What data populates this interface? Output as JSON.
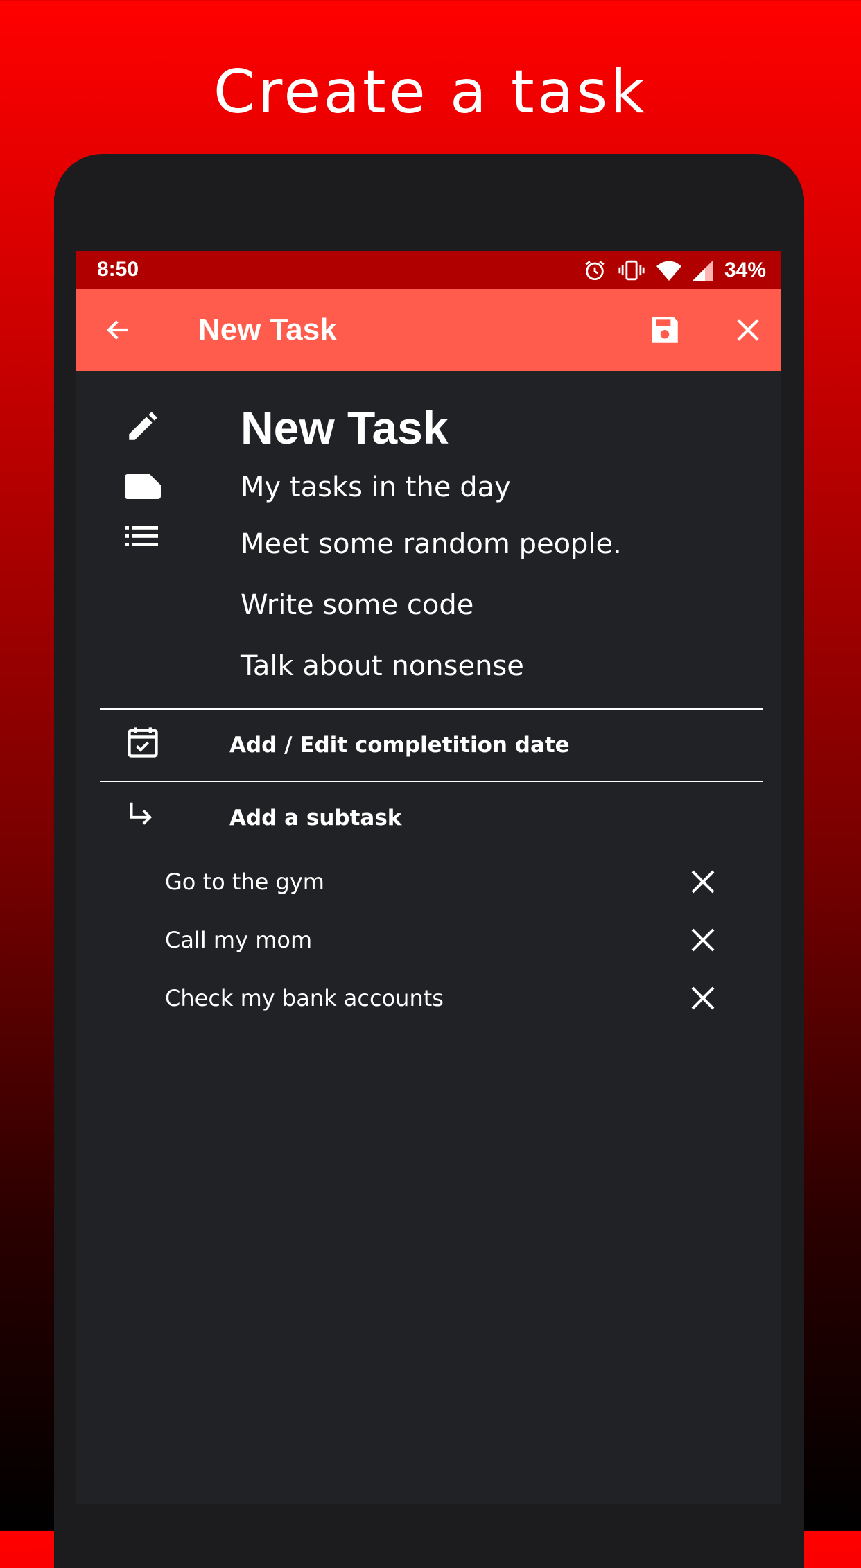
{
  "promo": {
    "title": "Create a task"
  },
  "status_bar": {
    "time": "8:50",
    "battery": "34%"
  },
  "app_bar": {
    "title": "New Task"
  },
  "task": {
    "title": "New Task",
    "category": "My tasks in the day",
    "description_lines": [
      "Meet some random people.",
      "Write some code",
      "Talk about nonsense"
    ]
  },
  "actions": {
    "date_label": "Add / Edit completition date",
    "subtask_label": "Add a subtask"
  },
  "subtasks": [
    {
      "text": "Go to the gym"
    },
    {
      "text": "Call my mom"
    },
    {
      "text": "Check my bank accounts"
    }
  ],
  "colors": {
    "accent": "#ff5c4d",
    "status_bar": "#b00000",
    "screen_bg": "#212225",
    "frame": "#1c1c1e"
  },
  "icons": {
    "back": "arrow-left-icon",
    "save": "floppy-disk-icon",
    "close": "close-icon",
    "title": "pencil-icon",
    "category": "label-icon",
    "description": "list-icon",
    "date": "calendar-check-icon",
    "subtask": "subdirectory-arrow-icon",
    "remove": "close-icon"
  }
}
